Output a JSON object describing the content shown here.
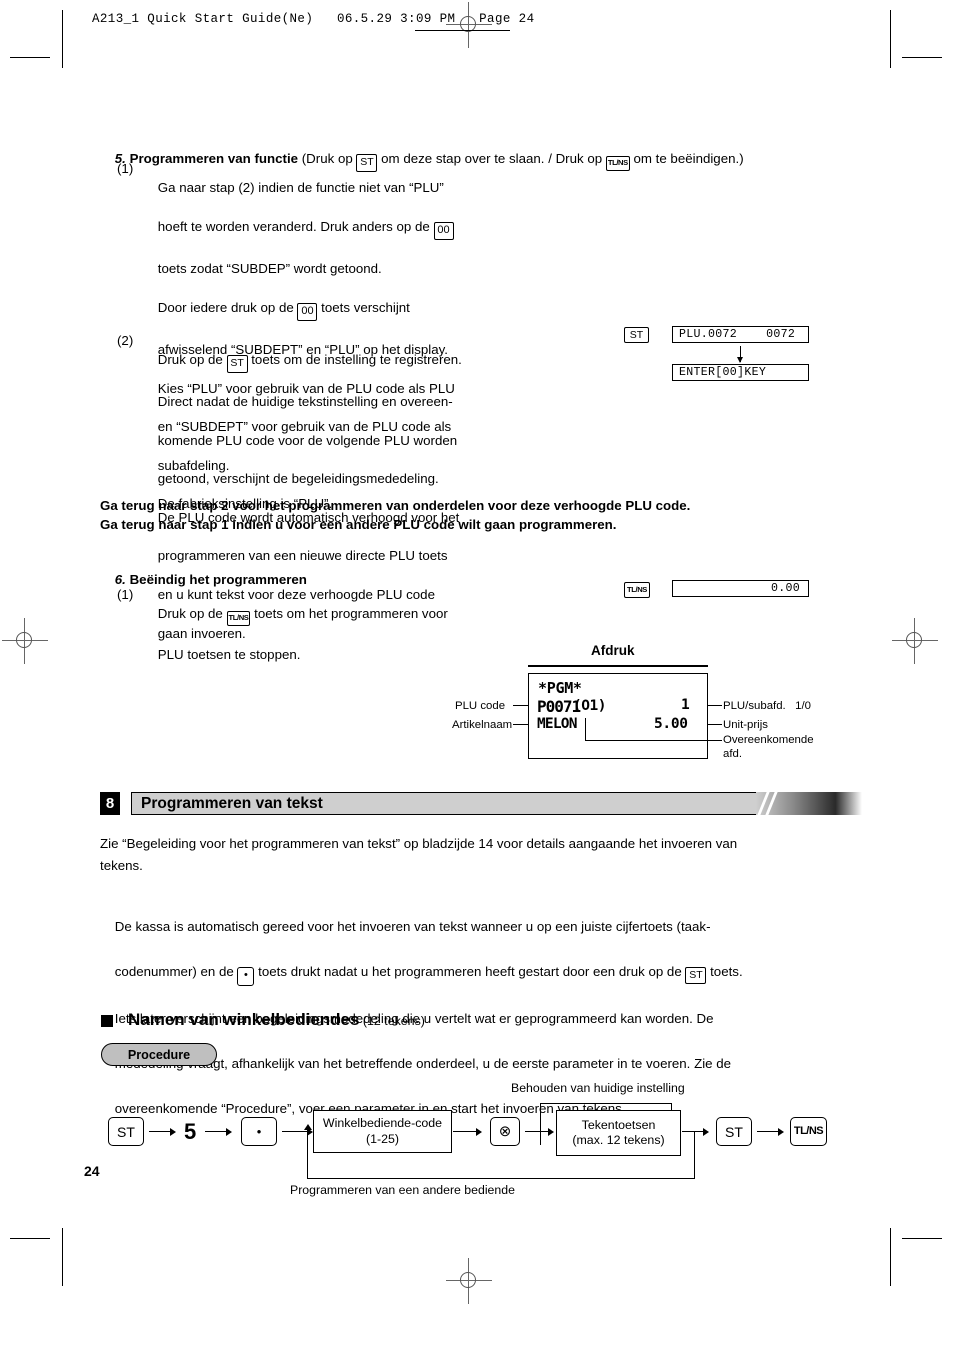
{
  "running_head": "A213_1 Quick Start Guide(Ne)   06.5.29 3:09 PM   Page 24",
  "page_number": "24",
  "section5": {
    "number": "5.",
    "title": "Programmeren van functie",
    "title_tail_a": " (Druk op ",
    "key_st": "ST",
    "title_tail_b": " om deze stap over te slaan. / Druk op ",
    "key_tlns": "TL/NS",
    "title_tail_c": " om te beëindigen.)",
    "item1": {
      "marker": "(1)",
      "line1_a": "Ga naar stap (2) indien de functie niet van “PLU”",
      "line2_a": "hoeft te worden veranderd. Druk anders op de ",
      "key_00": "00",
      "line3": "toets zodat “SUBDEP” wordt getoond.",
      "line4_a": "Door iedere druk op de ",
      "line4_b": " toets verschijnt",
      "line5": "afwisselend “SUBDEPT” en “PLU” op het display.",
      "line6": "Kies “PLU” voor gebruik van de PLU code als PLU",
      "line7": "en “SUBDEPT” voor gebruik van de PLU code als",
      "line8": "subafdeling.",
      "line9": "De fabrieksinstelling is “PLU”."
    },
    "item2": {
      "marker": "(2)",
      "line1_a": "Druk op de ",
      "line1_b": " toets om de instelling te registreren.",
      "line2": "Direct nadat de huidige tekstinstelling en overeen-",
      "line3": "komende PLU code voor de volgende PLU worden",
      "line4": "getoond, verschijnt de begeleidingsmededeling.",
      "line5": "De PLU code wordt automatisch verhoogd voor het",
      "line6": "programmeren van een nieuwe directe PLU toets",
      "line7": "en u kunt tekst voor deze verhoogde PLU code",
      "line8": "gaan invoeren."
    },
    "display_key": "ST",
    "display_1": "PLU.0072    0072",
    "display_2": "ENTER[00]KEY"
  },
  "note_lines": {
    "line1": "Ga terug naar stap 2 voor het programmeren van onderdelen voor deze verhoogde PLU code.",
    "line2": "Ga terug naar stap 1 indien u voor een andere PLU code wilt gaan programmeren."
  },
  "section6": {
    "number": "6.",
    "title": "Beëindig het programmeren",
    "item1": {
      "marker": "(1)",
      "line1_a": "Druk op de ",
      "key_tlns": "TL/NS",
      "line1_b": " toets om het programmeren voor",
      "line2": "PLU toetsen te stoppen."
    },
    "display_key": "TL/NS",
    "display_value": "0.00"
  },
  "afdruk": {
    "title": "Afdruk",
    "receipt": {
      "l1": "*PGM*",
      "l2_code": "P0071",
      "l2_dept": "(O1)",
      "l2_right": "1",
      "l3_name": "MELON",
      "l3_right": "5.00"
    },
    "left_labels": {
      "plu_code": "PLU code",
      "artikelnaam": "Artikelnaam"
    },
    "right_labels": {
      "plu_subafd": "PLU/subafd.   1/0",
      "unit_prijs": "Unit-prijs",
      "overeenkomende": "Overeenkomende",
      "overeenkomende2": "afd."
    }
  },
  "section8": {
    "number": "8",
    "title": "Programmeren van tekst",
    "intro": "Zie “Begeleiding voor het programmeren van tekst” op bladzijde 14 voor details aangaande het invoeren van\ntekens.",
    "body": {
      "l1": "De kassa is automatisch gereed voor het invoeren van tekst wanneer u op een juiste cijfertoets (taak-",
      "l2_a": "codenummer) en de ",
      "key_dot": "•",
      "l2_b": " toets drukt nadat u het programmeren heeft gestart door een druk op de ",
      "key_st": "ST",
      "l2_c": " toets.",
      "l3": "Iets later verschijnt een begeleidingsmededeling die u vertelt wat er geprogrammeerd kan worden. De",
      "l4": "mededeling vraagt, afhankelijk van het betreffende onderdeel, u de eerste parameter in te voeren. Zie de",
      "l5": "overeenkomende “Procedure”, voer een parameter in en start het invoeren van tekens."
    },
    "subheading": "Namen van winkelbediendes",
    "subheading_note": " (12 tekens)",
    "procedure_badge": "Procedure"
  },
  "flow": {
    "key_st_start": "ST",
    "num5": "5",
    "key_dot": "•",
    "box_code_l1": "Winkelbediende-code",
    "box_code_l2": "(1-25)",
    "key_multiply": "⊗",
    "box_chars_l1": "Tekentoetsen",
    "box_chars_l2": "(max. 12 tekens)",
    "key_st_end": "ST",
    "key_tlns_end": "TL/NS",
    "caption_top": "Behouden van huidige instelling",
    "caption_bottom": "Programmeren van een andere bediende"
  }
}
